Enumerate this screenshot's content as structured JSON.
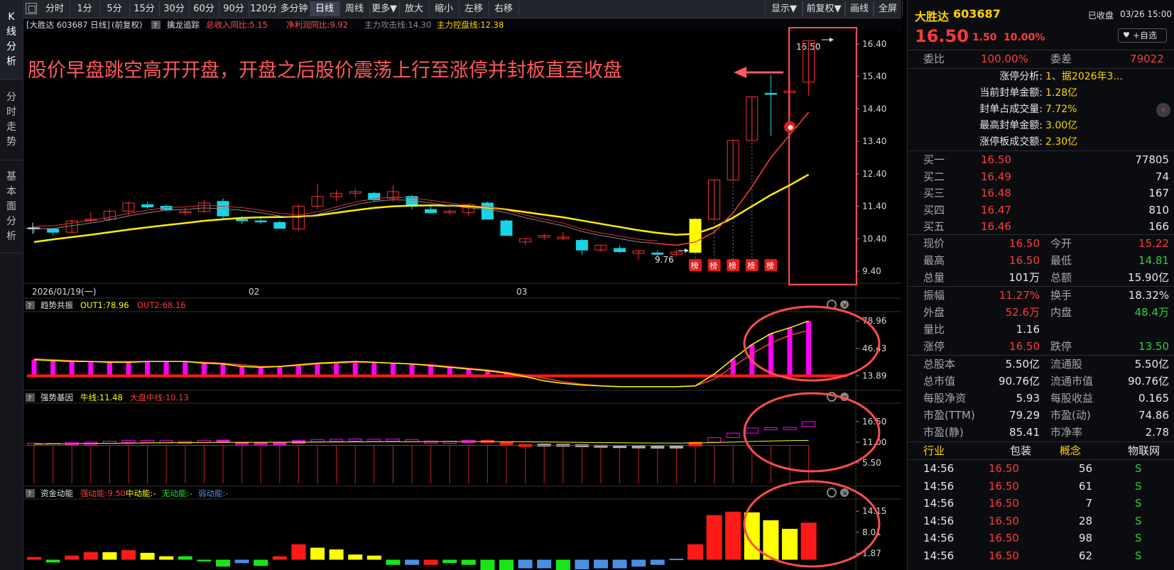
{
  "left_tabs": [
    {
      "label": [
        "K",
        "线",
        "分",
        "析"
      ]
    },
    {
      "label": [
        "分",
        "时",
        "走",
        "势"
      ]
    },
    {
      "label": [
        "基",
        "本",
        "面",
        "分",
        "析"
      ]
    }
  ],
  "toolbar": {
    "left_buttons": [
      "分时",
      "1分",
      "5分",
      "15分",
      "30分",
      "60分",
      "90分",
      "120分",
      "多分钟",
      "日线",
      "周线",
      "更多▼",
      "放大",
      "缩小",
      "左移",
      "右移"
    ],
    "active": "日线",
    "right_buttons": [
      "显示▼",
      "前复权▼",
      "画线",
      "全屏"
    ]
  },
  "main_chart": {
    "info": {
      "stock": "[大胜达 603687 日线]",
      "adj": "(前复权)",
      "help": "?",
      "indicator": "擒龙追踪",
      "rev": "总收入同比:5.15",
      "profit": "净利润同比:9.92",
      "attack": "主力攻击线:14.30",
      "control": "主力控盘线:12.38"
    },
    "annotation": "股价早盘跳空高开开盘，开盘之后股价震荡上行至涨停并封板直至收盘",
    "high_label": "16.50",
    "low_label": "9.76",
    "bang_label": "榜",
    "x_labels": [
      "2026/01/19(一)",
      "02",
      "03"
    ]
  },
  "chart_data": [
    {
      "type": "candlestick",
      "title": "大胜达 603687 日线",
      "ylim": [
        9.4,
        16.4
      ],
      "y_ticks": [
        "16.40",
        "15.40",
        "14.40",
        "13.40",
        "12.40",
        "11.40",
        "10.40",
        "9.40"
      ],
      "ohlc": [
        [
          10.74,
          10.78,
          10.58,
          10.7
        ],
        [
          10.7,
          10.72,
          10.5,
          10.6
        ],
        [
          10.6,
          11.0,
          10.58,
          10.95
        ],
        [
          11.0,
          11.22,
          10.9,
          11.0
        ],
        [
          11.0,
          11.3,
          10.95,
          11.25
        ],
        [
          11.25,
          11.55,
          11.1,
          11.5
        ],
        [
          11.45,
          11.55,
          11.32,
          11.38
        ],
        [
          11.4,
          11.45,
          11.25,
          11.3
        ],
        [
          11.2,
          11.35,
          11.1,
          11.24
        ],
        [
          11.24,
          11.6,
          11.2,
          11.5
        ],
        [
          11.55,
          11.65,
          11.0,
          11.1
        ],
        [
          11.0,
          11.1,
          10.85,
          10.95
        ],
        [
          10.95,
          11.05,
          10.85,
          10.92
        ],
        [
          10.9,
          10.95,
          10.7,
          10.72
        ],
        [
          10.7,
          11.45,
          10.65,
          11.4
        ],
        [
          11.4,
          12.1,
          11.3,
          11.7
        ],
        [
          11.7,
          11.9,
          11.55,
          11.8
        ],
        [
          11.8,
          11.95,
          11.65,
          11.85
        ],
        [
          11.8,
          11.85,
          11.55,
          11.6
        ],
        [
          11.65,
          12.05,
          11.55,
          11.85
        ],
        [
          11.7,
          11.75,
          11.3,
          11.4
        ],
        [
          11.3,
          11.4,
          11.2,
          11.2
        ],
        [
          11.2,
          11.3,
          11.15,
          11.25
        ],
        [
          11.2,
          11.5,
          11.1,
          11.45
        ],
        [
          11.5,
          11.55,
          11.0,
          11.0
        ],
        [
          10.95,
          11.0,
          10.5,
          10.5
        ],
        [
          10.3,
          10.4,
          10.2,
          10.4
        ],
        [
          10.45,
          10.55,
          10.35,
          10.5
        ],
        [
          10.4,
          10.6,
          10.35,
          10.45
        ],
        [
          10.35,
          10.4,
          9.9,
          10.05
        ],
        [
          10.05,
          10.2,
          10.0,
          10.2
        ],
        [
          10.1,
          10.2,
          9.95,
          10.0
        ],
        [
          9.95,
          10.05,
          9.76,
          10.02
        ],
        [
          9.96,
          10.05,
          9.85,
          9.92
        ],
        [
          9.92,
          10.05,
          9.85,
          9.99
        ],
        [
          9.98,
          11.05,
          9.98,
          11.0
        ],
        [
          11.0,
          12.21,
          11.0,
          12.21
        ],
        [
          12.21,
          13.43,
          12.21,
          13.43
        ],
        [
          13.43,
          14.77,
          13.43,
          14.77
        ],
        [
          14.88,
          15.45,
          13.56,
          14.86
        ],
        [
          14.9,
          15.4,
          14.1,
          14.95
        ],
        [
          15.22,
          16.5,
          14.81,
          16.5
        ]
      ],
      "limit_up_days": [
        35,
        36,
        37,
        38,
        39
      ],
      "ma_short": [
        10.7,
        10.72,
        10.8,
        10.88,
        10.98,
        11.1,
        11.2,
        11.28,
        11.3,
        11.35,
        11.32,
        11.28,
        11.2,
        11.1,
        11.05,
        11.15,
        11.3,
        11.45,
        11.55,
        11.6,
        11.58,
        11.5,
        11.42,
        11.35,
        11.3,
        11.2,
        11.05,
        10.92,
        10.8,
        10.62,
        10.5,
        10.4,
        10.3,
        10.25,
        10.2,
        10.3,
        10.6,
        11.2,
        12.0,
        12.9,
        13.6,
        14.3
      ],
      "ma_long": [
        10.3,
        10.38,
        10.45,
        10.52,
        10.6,
        10.68,
        10.75,
        10.82,
        10.88,
        10.95,
        11.0,
        11.04,
        11.06,
        11.07,
        11.08,
        11.12,
        11.2,
        11.28,
        11.35,
        11.4,
        11.42,
        11.43,
        11.42,
        11.4,
        11.36,
        11.3,
        11.22,
        11.14,
        11.06,
        10.96,
        10.86,
        10.76,
        10.66,
        10.58,
        10.52,
        10.55,
        10.75,
        11.05,
        11.4,
        11.75,
        12.05,
        12.38
      ]
    },
    {
      "type": "bar",
      "title": "趋势共振",
      "series_labels": [
        "OUT1:78.96",
        "OUT2:68.16"
      ],
      "y_ticks": [
        "78.96",
        "46.43",
        "13.89"
      ],
      "ylim": [
        0,
        80
      ],
      "values": [
        33,
        32,
        31,
        31,
        30,
        30,
        31,
        31,
        31,
        29,
        28,
        25,
        24,
        25,
        27,
        29,
        30,
        31,
        30,
        29,
        28,
        26,
        24,
        22,
        20,
        17,
        13,
        8,
        5,
        3,
        2,
        1,
        1,
        1,
        1,
        2,
        16,
        34,
        51,
        64,
        71,
        79
      ],
      "line1": [
        33,
        32,
        31,
        31,
        30,
        30,
        31,
        31,
        31,
        29,
        28,
        25,
        24,
        25,
        27,
        29,
        30,
        31,
        30,
        29,
        28,
        26,
        24,
        22,
        20,
        17,
        13,
        8,
        5,
        3,
        2,
        1,
        1,
        1,
        1,
        2,
        16,
        34,
        51,
        64,
        71,
        79
      ],
      "line2": [
        34,
        33,
        32,
        31,
        31,
        31,
        31,
        31,
        31,
        30,
        29,
        27,
        25,
        25,
        26,
        28,
        29,
        30,
        30,
        29,
        28,
        27,
        25,
        23,
        21,
        18,
        15,
        11,
        7,
        4,
        2,
        1,
        1,
        1,
        1,
        2,
        10,
        25,
        40,
        53,
        62,
        68
      ],
      "baseline": 13.89
    },
    {
      "type": "bar",
      "title": "强势基因",
      "series_labels": [
        "牛线:11.48",
        "大盘中线:10.13"
      ],
      "y_ticks": [
        "16.50",
        "11.00",
        "5.50"
      ],
      "ylim": [
        0,
        18
      ],
      "open": [
        10.74,
        10.7,
        10.6,
        11.0,
        11.0,
        11.25,
        11.45,
        11.4,
        11.2,
        11.24,
        11.55,
        11.0,
        10.95,
        10.9,
        10.7,
        11.4,
        11.7,
        11.8,
        11.8,
        11.65,
        11.7,
        11.3,
        11.2,
        11.2,
        11.5,
        10.95,
        10.3,
        10.45,
        10.4,
        10.35,
        10.05,
        10.1,
        9.95,
        9.96,
        9.92,
        9.98,
        11.0,
        12.21,
        13.43,
        14.88,
        14.9,
        15.22
      ],
      "close": [
        10.7,
        10.6,
        10.95,
        11.0,
        11.25,
        11.5,
        11.38,
        11.3,
        11.24,
        11.5,
        11.1,
        10.95,
        10.92,
        10.72,
        11.4,
        11.7,
        11.8,
        11.85,
        11.6,
        11.85,
        11.4,
        11.2,
        11.25,
        11.45,
        11.0,
        10.5,
        10.4,
        10.5,
        10.45,
        10.05,
        10.2,
        10.0,
        10.02,
        9.92,
        9.99,
        11.0,
        12.21,
        13.43,
        14.77,
        14.86,
        14.95,
        16.5
      ],
      "niu_line": [
        10.5,
        10.55,
        10.6,
        10.65,
        10.7,
        10.75,
        10.8,
        10.85,
        10.9,
        10.92,
        10.95,
        10.96,
        10.97,
        10.98,
        11.0,
        11.03,
        11.06,
        11.09,
        11.12,
        11.14,
        11.15,
        11.16,
        11.17,
        11.17,
        11.16,
        11.14,
        11.1,
        11.06,
        11.0,
        10.95,
        10.9,
        10.85,
        10.8,
        10.78,
        10.76,
        10.8,
        10.9,
        11.05,
        11.2,
        11.33,
        11.42,
        11.48
      ],
      "market_line": [
        10.13,
        10.13,
        10.13,
        10.13,
        10.13,
        10.13,
        10.13,
        10.13,
        10.13,
        10.13,
        10.13,
        10.13,
        10.13,
        10.13,
        10.13,
        10.13,
        10.13,
        10.13,
        10.13,
        10.13,
        10.13,
        10.13,
        10.13,
        10.13,
        10.13,
        10.13,
        10.13,
        10.13,
        10.13,
        10.13,
        10.13,
        10.13,
        10.13,
        10.13,
        10.13,
        10.13,
        10.13,
        10.13,
        10.13,
        10.13,
        10.13,
        10.13
      ]
    },
    {
      "type": "bar",
      "title": "资金动能",
      "series_labels": [
        "强动能:9.50",
        "中动能:-",
        "无动能:-",
        "弱动能:-"
      ],
      "y_ticks": [
        "14.15",
        "8.01",
        "1.87"
      ],
      "ylim": [
        -3,
        15
      ],
      "values": [
        0.8,
        -0.8,
        1.2,
        2.2,
        2.2,
        2.8,
        2.0,
        1.0,
        1.0,
        -0.5,
        -2.0,
        -1.0,
        -1.8,
        1.0,
        4.5,
        3.5,
        3.0,
        1.5,
        1.2,
        -1.5,
        -1.5,
        -1.5,
        -1.0,
        -1.5,
        -4.0,
        -4.2,
        -2.5,
        -2.5,
        -3.5,
        -2.8,
        -2.5,
        -2.5,
        -2.0,
        -1.5,
        0.3,
        4.5,
        13.0,
        14.0,
        13.8,
        11.5,
        9.0,
        10.8
      ],
      "colors": [
        "red",
        "green",
        "red",
        "red",
        "yellow",
        "red",
        "yellow",
        "yellow",
        "green",
        "green",
        "green",
        "blue",
        "green",
        "red",
        "red",
        "yellow",
        "yellow",
        "yellow",
        "yellow",
        "green",
        "blue",
        "red",
        "green",
        "green",
        "green",
        "green",
        "blue",
        "blue",
        "green",
        "blue",
        "blue",
        "blue",
        "blue",
        "blue",
        "blue",
        "red",
        "red",
        "red",
        "yellow",
        "yellow",
        "yellow",
        "red"
      ]
    }
  ],
  "sub_charts": {
    "trend": {
      "title": "趋势共振",
      "v1": "OUT1:78.96",
      "v2": "OUT2:68.16"
    },
    "strong": {
      "title": "强势基因",
      "v1": "牛线:11.48",
      "v2": "大盘中线:10.13"
    },
    "fund": {
      "title": "资金动能",
      "v1": "强动能:9.50",
      "v2": "中动能:-",
      "v3": "无动能:-",
      "v4": "弱动能:-"
    }
  },
  "right_panel": {
    "name": "大胜达",
    "code": "603687",
    "status": "已收盘",
    "datetime": "03/26 15:00",
    "price": "16.50",
    "change": "1.50",
    "pct": "10.00%",
    "watch_button": "+自选",
    "weibi_label": "委比",
    "weibi": "100.00%",
    "weicha_label": "委差",
    "weicha": "79022",
    "limit_analysis": [
      {
        "k": "涨停分析:",
        "v": "1、据2026年3..."
      },
      {
        "k": "当前封单金额:",
        "v": "1.28亿"
      },
      {
        "k": "封单占成交量:",
        "v": "7.72%"
      },
      {
        "k": "最高封单金额:",
        "v": "3.00亿"
      },
      {
        "k": "涨停板成交额:",
        "v": "2.30亿"
      }
    ],
    "bids": [
      {
        "label": "买一",
        "price": "16.50",
        "vol": "77805"
      },
      {
        "label": "买二",
        "price": "16.49",
        "vol": "74"
      },
      {
        "label": "买三",
        "price": "16.48",
        "vol": "167"
      },
      {
        "label": "买四",
        "price": "16.47",
        "vol": "810"
      },
      {
        "label": "买五",
        "price": "16.46",
        "vol": "166"
      }
    ],
    "stats1": [
      {
        "k1": "现价",
        "v1": "16.50",
        "c1": "red",
        "k2": "今开",
        "v2": "15.22",
        "c2": "red"
      },
      {
        "k1": "最高",
        "v1": "16.50",
        "c1": "red",
        "k2": "最低",
        "v2": "14.81",
        "c2": "green"
      },
      {
        "k1": "总量",
        "v1": "101万",
        "c1": "white",
        "k2": "总额",
        "v2": "15.90亿",
        "c2": "white"
      }
    ],
    "stats2": [
      {
        "k1": "振幅",
        "v1": "11.27%",
        "c1": "red",
        "k2": "换手",
        "v2": "18.32%",
        "c2": "white"
      },
      {
        "k1": "外盘",
        "v1": "52.6万",
        "c1": "red",
        "k2": "内盘",
        "v2": "48.4万",
        "c2": "green"
      },
      {
        "k1": "量比",
        "v1": "1.16",
        "c1": "white",
        "k2": "",
        "v2": "",
        "c2": "white"
      },
      {
        "k1": "涨停",
        "v1": "16.50",
        "c1": "red",
        "k2": "跌停",
        "v2": "13.50",
        "c2": "green"
      }
    ],
    "stats3": [
      {
        "k1": "总股本",
        "v1": "5.50亿",
        "k2": "流通股",
        "v2": "5.50亿"
      },
      {
        "k1": "总市值",
        "v1": "90.76亿",
        "k2": "流通市值",
        "v2": "90.76亿"
      },
      {
        "k1": "每股净资",
        "v1": "5.93",
        "k2": "每股收益",
        "v2": "0.165"
      },
      {
        "k1": "市盈(TTM)",
        "v1": "79.29",
        "k2": "市盈(动)",
        "v2": "74.86"
      },
      {
        "k1": "市盈(静)",
        "v1": "85.41",
        "k2": "市净率",
        "v2": "2.78"
      }
    ],
    "industry": {
      "k1": "行业",
      "v1": "包装",
      "k2": "概念",
      "v2": "物联网"
    },
    "trades": [
      {
        "time": "14:56",
        "price": "16.50",
        "vol": "56",
        "side": "S"
      },
      {
        "time": "14:56",
        "price": "16.50",
        "vol": "61",
        "side": "S"
      },
      {
        "time": "14:56",
        "price": "16.50",
        "vol": "7",
        "side": "S"
      },
      {
        "time": "14:56",
        "price": "16.50",
        "vol": "28",
        "side": "S"
      },
      {
        "time": "14:56",
        "price": "16.50",
        "vol": "98",
        "side": "S"
      },
      {
        "time": "14:56",
        "price": "16.50",
        "vol": "62",
        "side": "S"
      }
    ]
  },
  "colors": {
    "up": "#ff3030",
    "down": "#17d4e6",
    "ma_short": "#ff3b3b",
    "ma_long": "#ffee00",
    "magenta": "#ff00ff",
    "yellow": "#ffff00",
    "green": "#19e619",
    "blue": "#4a90e2",
    "annotation_red": "#ff5a5a",
    "circle": "#ff4d4d"
  }
}
